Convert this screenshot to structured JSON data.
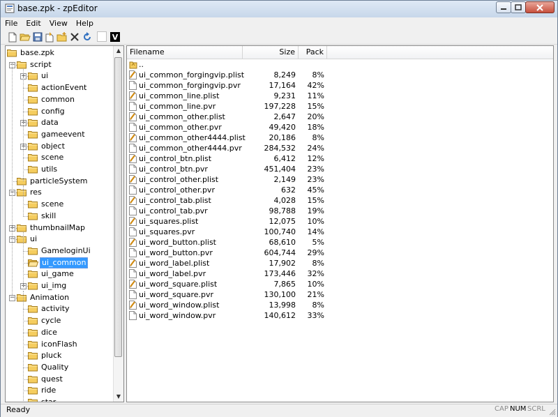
{
  "window": {
    "title": "base.zpk - zpEditor"
  },
  "menu": [
    "File",
    "Edit",
    "View",
    "Help"
  ],
  "toolbar": {
    "buttons": [
      "new-icon",
      "open-icon",
      "save-icon",
      "extract-icon",
      "add-folder-icon",
      "delete-icon",
      "refresh-icon",
      "blank-icon",
      "v-icon"
    ],
    "v_label": "V"
  },
  "tree": {
    "root": "base.zpk",
    "items": [
      {
        "label": "script",
        "level": 1,
        "expander": "minus"
      },
      {
        "label": "ui",
        "level": 2,
        "expander": "plus"
      },
      {
        "label": "actionEvent",
        "level": 2,
        "expander": ""
      },
      {
        "label": "common",
        "level": 2,
        "expander": ""
      },
      {
        "label": "config",
        "level": 2,
        "expander": ""
      },
      {
        "label": "data",
        "level": 2,
        "expander": "plus"
      },
      {
        "label": "gameevent",
        "level": 2,
        "expander": ""
      },
      {
        "label": "object",
        "level": 2,
        "expander": "plus"
      },
      {
        "label": "scene",
        "level": 2,
        "expander": ""
      },
      {
        "label": "utils",
        "level": 2,
        "expander": ""
      },
      {
        "label": "particleSystem",
        "level": 1,
        "expander": ""
      },
      {
        "label": "res",
        "level": 1,
        "expander": "minus"
      },
      {
        "label": "scene",
        "level": 2,
        "expander": ""
      },
      {
        "label": "skill",
        "level": 2,
        "expander": ""
      },
      {
        "label": "thumbnailMap",
        "level": 1,
        "expander": "plus"
      },
      {
        "label": "ui",
        "level": 1,
        "expander": "minus"
      },
      {
        "label": "GameloginUi",
        "level": 2,
        "expander": ""
      },
      {
        "label": "ui_common",
        "level": 2,
        "expander": "",
        "selected": true
      },
      {
        "label": "ui_game",
        "level": 2,
        "expander": ""
      },
      {
        "label": "ui_img",
        "level": 2,
        "expander": "plus"
      },
      {
        "label": "Animation",
        "level": 1,
        "expander": "minus"
      },
      {
        "label": "activity",
        "level": 2,
        "expander": ""
      },
      {
        "label": "cycle",
        "level": 2,
        "expander": ""
      },
      {
        "label": "dice",
        "level": 2,
        "expander": ""
      },
      {
        "label": "iconFlash",
        "level": 2,
        "expander": ""
      },
      {
        "label": "pluck",
        "level": 2,
        "expander": ""
      },
      {
        "label": "Quality",
        "level": 2,
        "expander": ""
      },
      {
        "label": "quest",
        "level": 2,
        "expander": ""
      },
      {
        "label": "ride",
        "level": 2,
        "expander": ""
      },
      {
        "label": "star",
        "level": 2,
        "expander": ""
      }
    ]
  },
  "list": {
    "columns": {
      "filename": "Filename",
      "size": "Size",
      "pack": "Pack"
    },
    "parent_entry": "..",
    "files": [
      {
        "name": "ui_common_forgingvip.plist",
        "size": "8,249",
        "pack": "8%",
        "type": "plist"
      },
      {
        "name": "ui_common_forgingvip.pvr",
        "size": "17,164",
        "pack": "42%",
        "type": "pvr"
      },
      {
        "name": "ui_common_line.plist",
        "size": "9,231",
        "pack": "11%",
        "type": "plist"
      },
      {
        "name": "ui_common_line.pvr",
        "size": "197,228",
        "pack": "15%",
        "type": "pvr"
      },
      {
        "name": "ui_common_other.plist",
        "size": "2,647",
        "pack": "20%",
        "type": "plist"
      },
      {
        "name": "ui_common_other.pvr",
        "size": "49,420",
        "pack": "18%",
        "type": "pvr"
      },
      {
        "name": "ui_common_other4444.plist",
        "size": "20,186",
        "pack": "8%",
        "type": "plist"
      },
      {
        "name": "ui_common_other4444.pvr",
        "size": "284,532",
        "pack": "24%",
        "type": "pvr"
      },
      {
        "name": "ui_control_btn.plist",
        "size": "6,412",
        "pack": "12%",
        "type": "plist"
      },
      {
        "name": "ui_control_btn.pvr",
        "size": "451,404",
        "pack": "23%",
        "type": "pvr"
      },
      {
        "name": "ui_control_other.plist",
        "size": "2,149",
        "pack": "23%",
        "type": "plist"
      },
      {
        "name": "ui_control_other.pvr",
        "size": "632",
        "pack": "45%",
        "type": "pvr"
      },
      {
        "name": "ui_control_tab.plist",
        "size": "4,028",
        "pack": "15%",
        "type": "plist"
      },
      {
        "name": "ui_control_tab.pvr",
        "size": "98,788",
        "pack": "19%",
        "type": "pvr"
      },
      {
        "name": "ui_squares.plist",
        "size": "12,075",
        "pack": "10%",
        "type": "plist"
      },
      {
        "name": "ui_squares.pvr",
        "size": "100,740",
        "pack": "14%",
        "type": "pvr"
      },
      {
        "name": "ui_word_button.plist",
        "size": "68,610",
        "pack": "5%",
        "type": "plist"
      },
      {
        "name": "ui_word_button.pvr",
        "size": "604,744",
        "pack": "29%",
        "type": "pvr"
      },
      {
        "name": "ui_word_label.plist",
        "size": "17,902",
        "pack": "8%",
        "type": "plist"
      },
      {
        "name": "ui_word_label.pvr",
        "size": "173,446",
        "pack": "32%",
        "type": "pvr"
      },
      {
        "name": "ui_word_square.plist",
        "size": "7,865",
        "pack": "10%",
        "type": "plist"
      },
      {
        "name": "ui_word_square.pvr",
        "size": "130,100",
        "pack": "21%",
        "type": "pvr"
      },
      {
        "name": "ui_word_window.plist",
        "size": "13,998",
        "pack": "8%",
        "type": "plist"
      },
      {
        "name": "ui_word_window.pvr",
        "size": "140,612",
        "pack": "33%",
        "type": "pvr"
      }
    ]
  },
  "status": {
    "text": "Ready",
    "indicators": [
      {
        "label": "CAP",
        "active": false
      },
      {
        "label": "NUM",
        "active": true
      },
      {
        "label": "SCRL",
        "active": false
      }
    ]
  },
  "colors": {
    "selection": "#3399ff",
    "folder": "#f5cd5f",
    "titlebar": "#c7d7ea"
  }
}
